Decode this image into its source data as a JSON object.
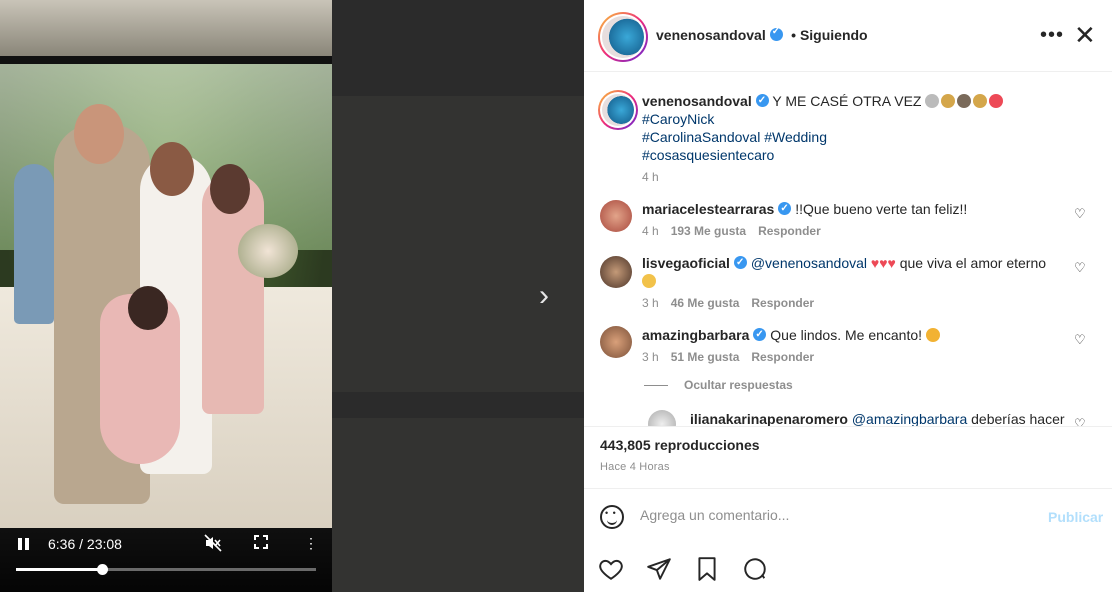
{
  "video": {
    "time_display": "6:36 / 23:08",
    "progress": 0.285
  },
  "header": {
    "username": "venenosandoval",
    "follow_state": "• Siguiendo"
  },
  "caption": {
    "username": "venenosandoval",
    "text": "Y ME CASÉ OTRA VEZ",
    "hashtags_line1": "#CaroyNick",
    "hashtags_line2": "#CarolinaSandoval #Wedding",
    "hashtags_line3": "#cosasquesientecaro",
    "time": "4 h"
  },
  "comments": [
    {
      "username": "mariacelestearraras",
      "text": "!!Que bueno verte tan feliz!!",
      "time": "4 h",
      "likes": "193 Me gusta",
      "reply": "Responder"
    },
    {
      "username": "lisvegaoficial",
      "mention": "@venenosandoval",
      "text": "que viva el amor eterno",
      "time": "3 h",
      "likes": "46 Me gusta",
      "reply": "Responder"
    },
    {
      "username": "amazingbarbara",
      "text": "Que lindos. Me encanto!",
      "time": "3 h",
      "likes": "51 Me gusta",
      "reply": "Responder"
    }
  ],
  "replies_toggle": "Ocultar respuestas",
  "reply": {
    "username": "ilianakarinapenaromero",
    "mention": "@amazingbarbara",
    "text": "deberías hacer"
  },
  "stats": {
    "views": "443,805 reproducciones",
    "time_ago": "Hace 4 Horas"
  },
  "add_comment": {
    "placeholder": "Agrega un comentario...",
    "publish_label": "Publicar"
  },
  "colors": {
    "verified": "#3897f0",
    "hashtag": "#00376b",
    "publish_disabled": "#b2dffc",
    "heart_red": "#ed4956"
  }
}
